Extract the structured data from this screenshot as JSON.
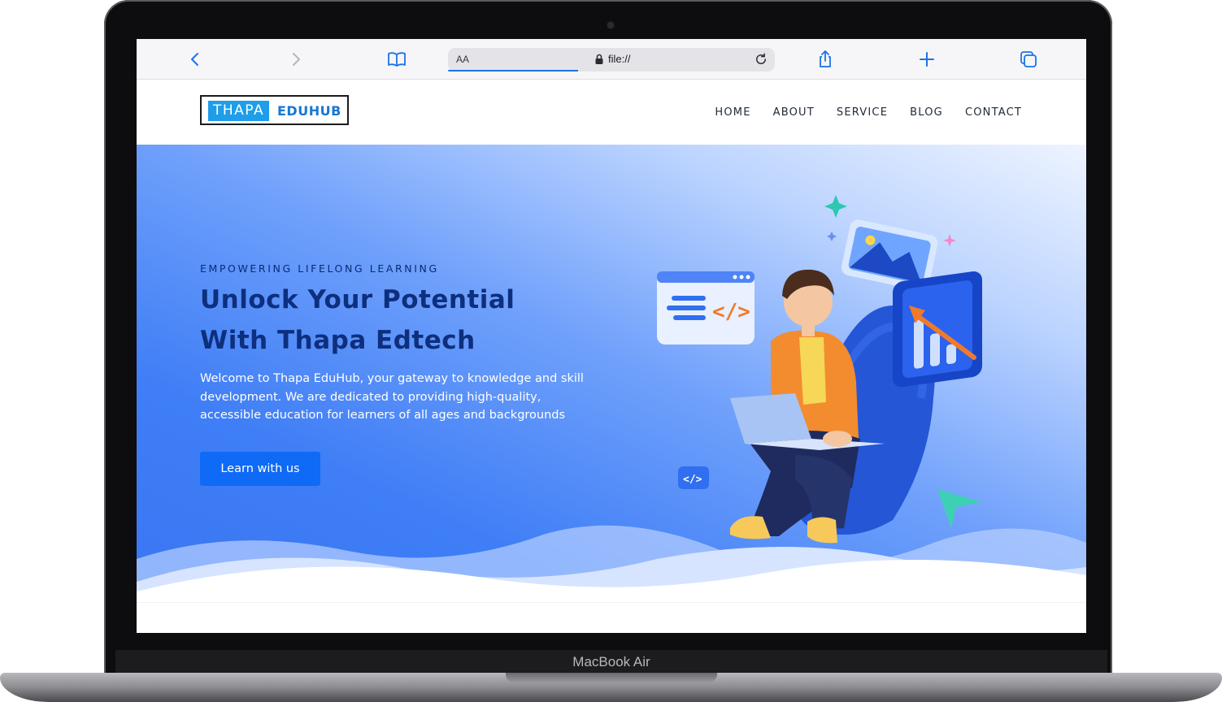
{
  "device": {
    "label": "MacBook Air"
  },
  "browser": {
    "text_size_label": "AA",
    "url": "file://",
    "icons": [
      "back-icon",
      "forward-icon",
      "bookmarks-icon",
      "lock-icon",
      "reload-icon",
      "share-icon",
      "new-tab-icon",
      "tabs-icon"
    ]
  },
  "site": {
    "logo": {
      "part1": "THAPA",
      "part2": "EDUHUB"
    },
    "nav": [
      "HOME",
      "ABOUT",
      "SERVICE",
      "BLOG",
      "CONTACT"
    ],
    "hero": {
      "eyebrow": "EMPOWERING LIFELONG LEARNING",
      "title_line1": "Unlock Your Potential",
      "title_line2": "With Thapa Edtech",
      "description": "Welcome to Thapa EduHub, your gateway to knowledge and skill development. We are dedicated to providing high-quality, accessible education for learners of all ages and backgrounds",
      "cta": "Learn with us"
    }
  },
  "colors": {
    "accent": "#0f6af6",
    "title": "#0d2f7e",
    "logo_blue": "#1e9dea"
  }
}
